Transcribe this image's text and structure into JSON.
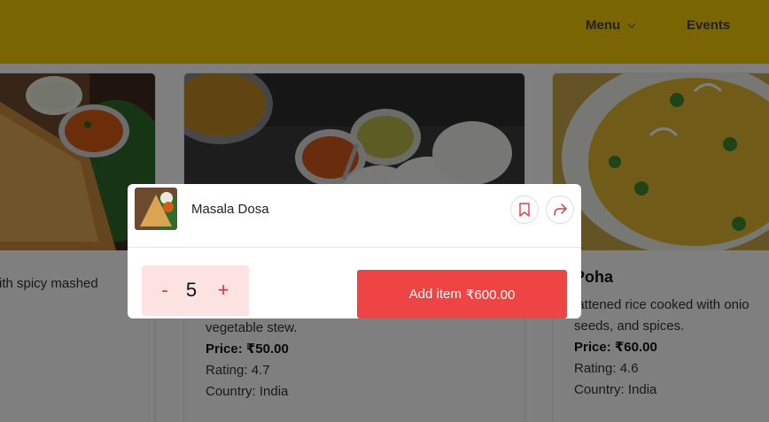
{
  "nav": {
    "menu_label": "Menu",
    "events_label": "Events"
  },
  "cards": [
    {
      "title": "",
      "desc_line1": "ith spicy mashed",
      "desc_line2": "",
      "price": "",
      "rating": "",
      "country": ""
    },
    {
      "title": "",
      "desc_line1": "",
      "desc_line2": "vegetable stew.",
      "price": "Price: ₹50.00",
      "rating": "Rating: 4.7",
      "country": "Country: India"
    },
    {
      "title": "Poha",
      "desc_line1": "lattened rice cooked with onio",
      "desc_line2": "seeds, and spices.",
      "price": "Price: ₹60.00",
      "rating": "Rating: 4.6",
      "country": "Country: India"
    }
  ],
  "modal": {
    "item_name": "Masala Dosa",
    "quantity": "5",
    "minus_label": "-",
    "plus_label": "+",
    "add_label": "Add item",
    "add_price": "₹600.00"
  },
  "icons": {
    "bookmark": "bookmark-icon",
    "share": "share-icon",
    "chevron": "chevron-down-icon"
  },
  "colors": {
    "header": "#f3cb04",
    "accent": "#ef4444",
    "qty_bg": "#fde2e2"
  }
}
